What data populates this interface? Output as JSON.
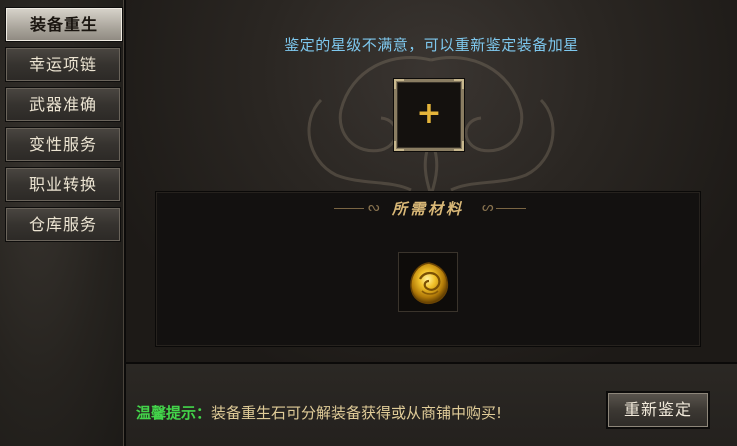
{
  "sidebar": {
    "items": [
      {
        "label": "装备重生",
        "active": true
      },
      {
        "label": "幸运项链",
        "active": false
      },
      {
        "label": "武器准确",
        "active": false
      },
      {
        "label": "变性服务",
        "active": false
      },
      {
        "label": "职业转换",
        "active": false
      },
      {
        "label": "仓库服务",
        "active": false
      }
    ]
  },
  "main": {
    "header": "鉴定的星级不满意，可以重新鉴定装备加星",
    "equip_slot_symbol": "+",
    "materials_title": "所需材料",
    "material_icon": "golden-rebirth-stone-icon"
  },
  "footer": {
    "tip_label": "温馨提示：",
    "tip_text": "装备重生石可分解装备获得或从商铺中购买!",
    "button_label": "重新鉴定"
  },
  "colors": {
    "header_text": "#7ec8ee",
    "tip_label": "#43d44a",
    "tip_text": "#e0cc98",
    "materials_title": "#d9b877",
    "plus_gold": "#e4b43a"
  }
}
